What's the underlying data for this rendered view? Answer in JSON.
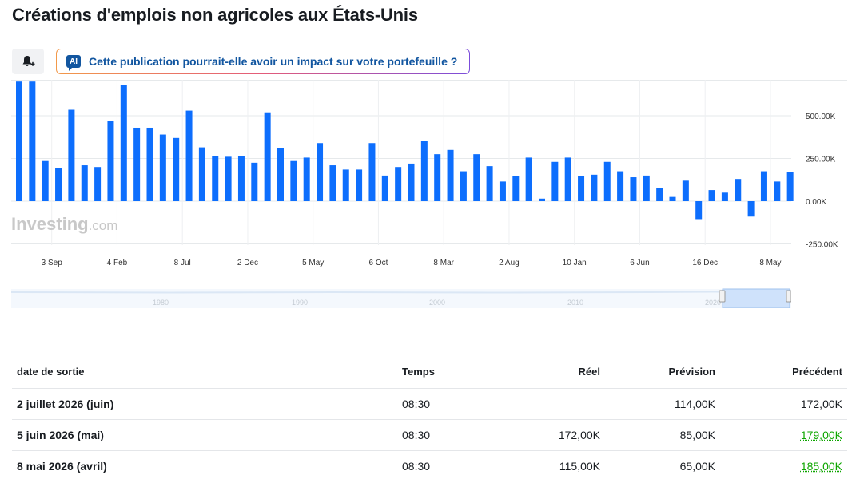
{
  "page": {
    "title": "Créations d'emplois non agricoles aux États-Unis"
  },
  "toolbar": {
    "alert_icon": "bell-plus-icon",
    "ai_badge": "AI",
    "ai_text": "Cette publication pourrait-elle avoir un impact sur votre portefeuille ?"
  },
  "watermark": {
    "brand": "Investing",
    "suffix": ".com"
  },
  "chart_data": {
    "type": "bar",
    "color": "#0d6efd",
    "ylim": [
      -250,
      700
    ],
    "y_ticks": [
      {
        "value": 500,
        "label": "500.00K"
      },
      {
        "value": 250,
        "label": "250.00K"
      },
      {
        "value": 0,
        "label": "0.00K"
      },
      {
        "value": -250,
        "label": "-250.00K"
      }
    ],
    "x_ticks": [
      "3 Sep",
      "4 Feb",
      "8 Jul",
      "2 Dec",
      "5 May",
      "6 Oct",
      "8 Mar",
      "2 Aug",
      "10 Jan",
      "6 Jun",
      "16 Dec",
      "8 May"
    ],
    "x_tick_bar_index": [
      2,
      7,
      12,
      17,
      22,
      27,
      32,
      37,
      42,
      47,
      52,
      57
    ],
    "values": [
      700,
      700,
      235,
      195,
      535,
      210,
      200,
      470,
      680,
      430,
      430,
      390,
      370,
      530,
      315,
      265,
      260,
      265,
      225,
      520,
      310,
      235,
      255,
      340,
      210,
      185,
      185,
      340,
      150,
      200,
      220,
      355,
      275,
      300,
      175,
      275,
      205,
      115,
      145,
      255,
      15,
      230,
      255,
      145,
      155,
      230,
      175,
      140,
      150,
      75,
      25,
      120,
      -105,
      65,
      50,
      130,
      -90,
      175,
      115,
      170
    ]
  },
  "navigator": {
    "labels": [
      "1980",
      "1990",
      "2000",
      "2010",
      "2020"
    ]
  },
  "table": {
    "headers": {
      "date": "date de sortie",
      "time": "Temps",
      "actual": "Réel",
      "forecast": "Prévision",
      "previous": "Précédent"
    },
    "rows": [
      {
        "date": "2 juillet 2026 (juin)",
        "time": "08:30",
        "actual": "",
        "forecast": "114,00K",
        "previous": "172,00K"
      },
      {
        "date": "5 juin 2026 (mai)",
        "time": "08:30",
        "actual": "172,00K",
        "forecast": "85,00K",
        "previous": "179,00K"
      },
      {
        "date": "8 mai 2026 (avril)",
        "time": "08:30",
        "actual": "115,00K",
        "forecast": "65,00K",
        "previous": "185,00K"
      }
    ]
  }
}
